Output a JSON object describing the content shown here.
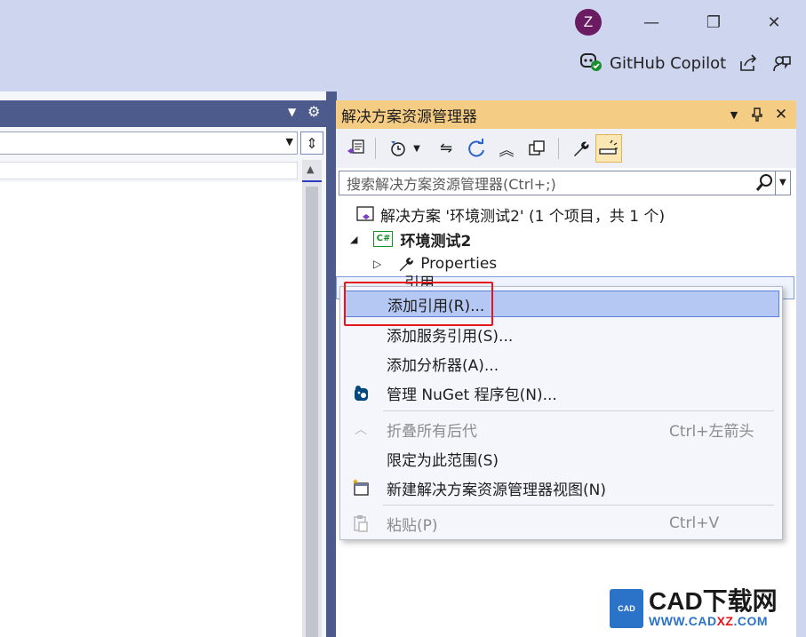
{
  "window": {
    "avatar_initial": "Z",
    "minimize_glyph": "—",
    "restore_glyph": "❐",
    "close_glyph": "✕",
    "copilot_label": "GitHub Copilot"
  },
  "solution_explorer": {
    "title": "解决方案资源管理器",
    "search_placeholder": "搜索解决方案资源管理器(Ctrl+;)",
    "tree": {
      "solution": "解决方案 '环境测试2' (1 个项目，共 1 个)",
      "project": "环境测试2",
      "project_badge": "C#",
      "properties": "Properties",
      "references_partial": "引用"
    }
  },
  "context_menu": {
    "items": [
      {
        "label": "添加引用(R)...",
        "shortcut": "",
        "icon": "",
        "state": "highlighted"
      },
      {
        "label": "添加服务引用(S)...",
        "shortcut": "",
        "icon": "",
        "state": "normal"
      },
      {
        "label": "添加分析器(A)...",
        "shortcut": "",
        "icon": "",
        "state": "normal"
      },
      {
        "label": "管理 NuGet 程序包(N)...",
        "shortcut": "",
        "icon": "nuget-icon",
        "state": "normal"
      },
      {
        "label": "折叠所有后代",
        "shortcut": "Ctrl+左箭头",
        "icon": "collapse-icon",
        "state": "disabled"
      },
      {
        "label": "限定为此范围(S)",
        "shortcut": "",
        "icon": "",
        "state": "normal"
      },
      {
        "label": "新建解决方案资源管理器视图(N)",
        "shortcut": "",
        "icon": "new-view-icon",
        "state": "normal"
      },
      {
        "label": "粘贴(P)",
        "shortcut": "Ctrl+V",
        "icon": "paste-icon",
        "state": "disabled"
      }
    ]
  },
  "watermark": {
    "logo_text": "CAD",
    "brand_line1": "CAD下载网",
    "brand_line2_a": "WWW.CAD",
    "brand_line2_b": "XZ",
    "brand_line2_c": ".COM"
  },
  "colors": {
    "title_bg": "#cdd6ee",
    "se_header": "#f5cc84",
    "menu_highlight": "#b5c8f4",
    "red_annotation": "#e4161b"
  }
}
